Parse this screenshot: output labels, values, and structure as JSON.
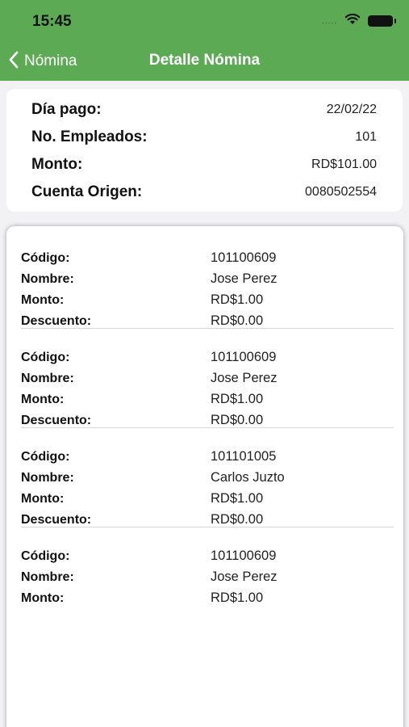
{
  "status_bar": {
    "time": "15:45",
    "signal": "....."
  },
  "nav": {
    "back_label": "Nómina",
    "title": "Detalle Nómina"
  },
  "summary": {
    "rows": [
      {
        "label": "Día pago:",
        "value": "22/02/22"
      },
      {
        "label": "No. Empleados:",
        "value": "101"
      },
      {
        "label": "Monto:",
        "value": "RD$101.00"
      },
      {
        "label": "Cuenta Origen:",
        "value": "0080502554"
      }
    ]
  },
  "labels": {
    "codigo": "Código:",
    "nombre": "Nombre:",
    "monto": "Monto:",
    "descuento": "Descuento:"
  },
  "employees": [
    {
      "codigo": "101100609",
      "nombre": "Jose Perez",
      "monto": "RD$1.00",
      "descuento": "RD$0.00"
    },
    {
      "codigo": "101100609",
      "nombre": "Jose Perez",
      "monto": "RD$1.00",
      "descuento": "RD$0.00"
    },
    {
      "codigo": "101101005",
      "nombre": "Carlos Juzto",
      "monto": "RD$1.00",
      "descuento": "RD$0.00"
    },
    {
      "codigo": "101100609",
      "nombre": "Jose Perez",
      "monto": "RD$1.00"
    }
  ],
  "colors": {
    "header_green": "#5daa55"
  }
}
